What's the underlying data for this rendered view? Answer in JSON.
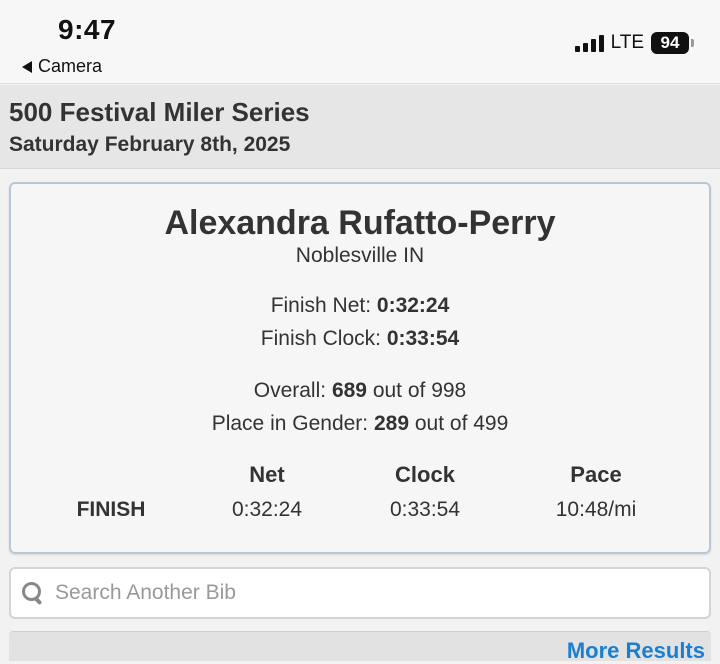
{
  "status_bar": {
    "time": "9:47",
    "back_label": "Camera",
    "network": "LTE",
    "battery": "94"
  },
  "event": {
    "title": "500 Festival Miler Series",
    "date": "Saturday February 8th, 2025"
  },
  "runner": {
    "name": "Alexandra Rufatto-Perry",
    "location": "Noblesville IN",
    "finish_net_label": "Finish Net:",
    "finish_net_value": "0:32:24",
    "finish_clock_label": "Finish Clock:",
    "finish_clock_value": "0:33:54",
    "overall_label": "Overall:",
    "overall_place": "689",
    "overall_of": "out of 998",
    "gender_label": "Place in Gender:",
    "gender_place": "289",
    "gender_of": "out of 499"
  },
  "splits": {
    "headers": [
      "",
      "Net",
      "Clock",
      "Pace"
    ],
    "rows": [
      {
        "label": "FINISH",
        "net": "0:32:24",
        "clock": "0:33:54",
        "pace": "10:48/mi"
      }
    ]
  },
  "search": {
    "placeholder": "Search Another Bib",
    "value": ""
  },
  "footer": {
    "more_results": "More Results"
  },
  "colors": {
    "link": "#1a7fd1",
    "card_border": "#b7c7d8"
  }
}
